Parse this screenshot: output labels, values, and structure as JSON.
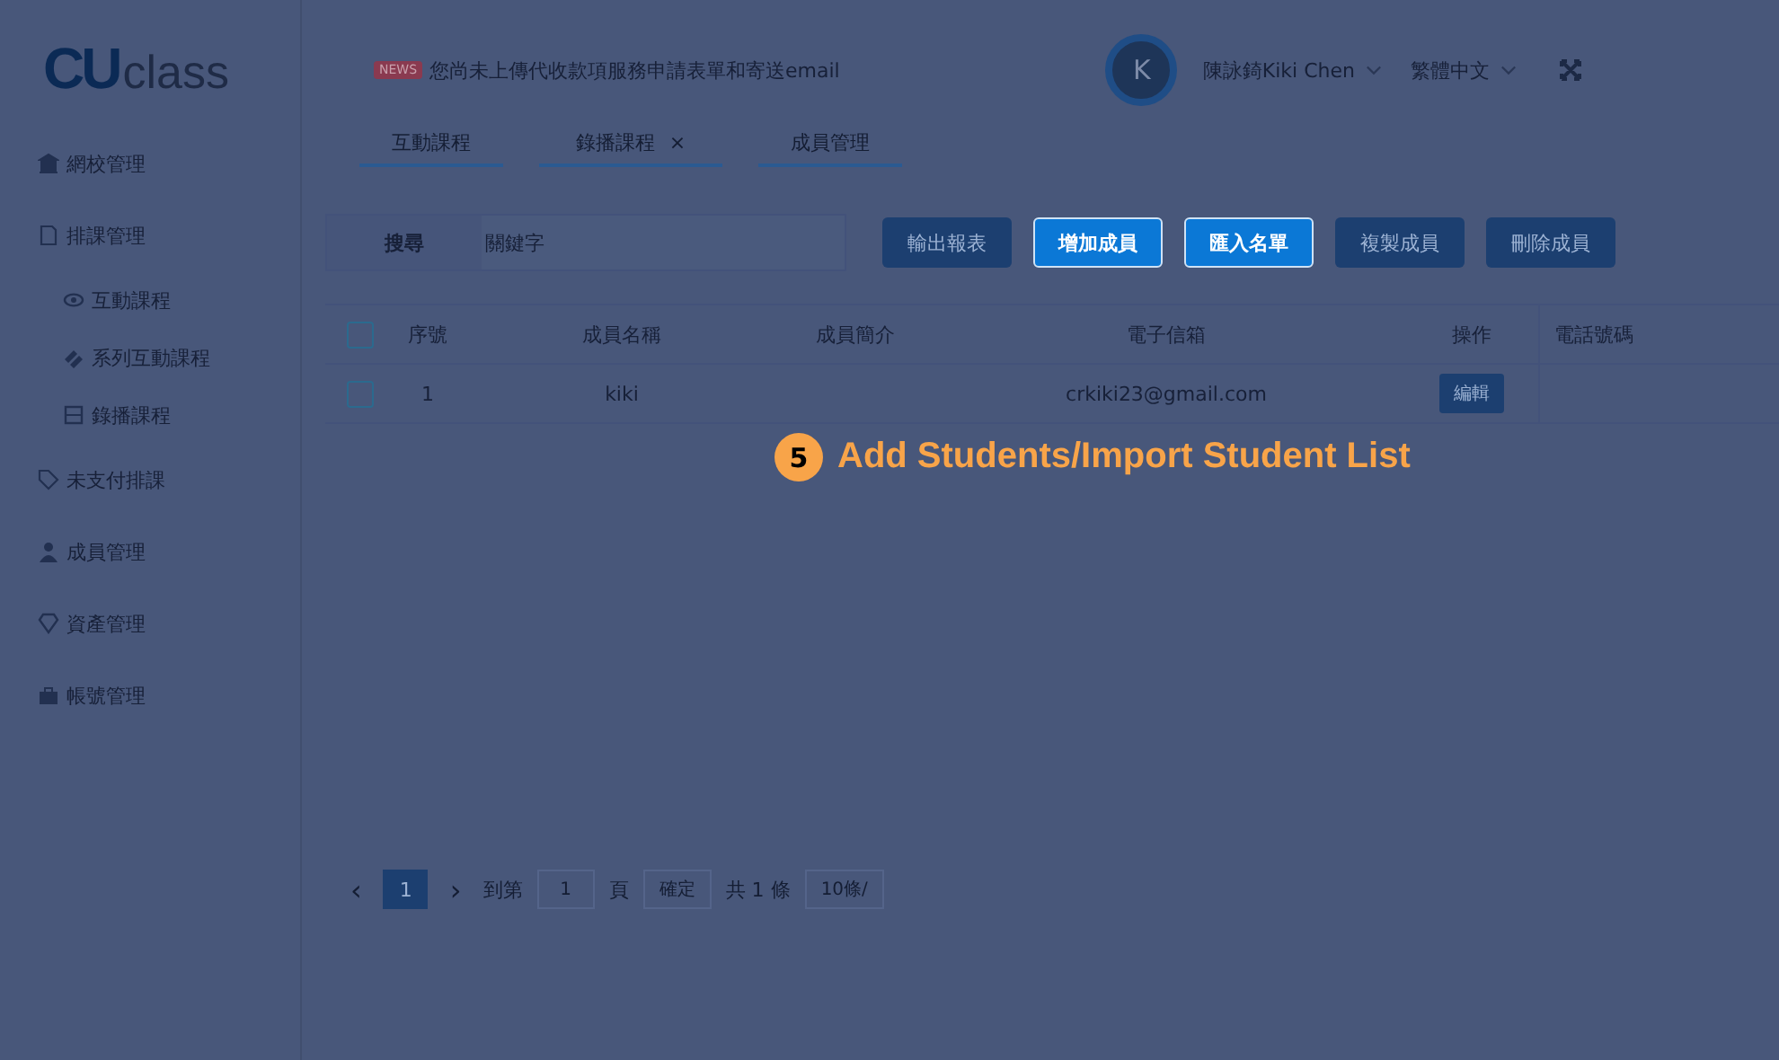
{
  "logo": {
    "mark": "CU",
    "text": "class"
  },
  "notice": {
    "badge": "NEWS",
    "text": "您尚未上傳代收款項服務申請表單和寄送email"
  },
  "user": {
    "avatar": "K",
    "name": "陳詠錡Kiki Chen",
    "language": "繁體中文"
  },
  "sidebar": {
    "items": [
      {
        "label": "網校管理"
      },
      {
        "label": "排課管理",
        "children": [
          {
            "label": "互動課程"
          },
          {
            "label": "系列互動課程"
          },
          {
            "label": "錄播課程"
          }
        ]
      },
      {
        "label": "未支付排課"
      },
      {
        "label": "成員管理"
      },
      {
        "label": "資產管理"
      },
      {
        "label": "帳號管理"
      }
    ]
  },
  "tabs": [
    {
      "label": "互動課程"
    },
    {
      "label": "錄播課程",
      "close": "×"
    },
    {
      "label": "成員管理"
    }
  ],
  "search": {
    "label": "搜尋",
    "placeholder": "關鍵字"
  },
  "buttons": [
    {
      "label": "輸出報表",
      "highlighted": false
    },
    {
      "label": "增加成員",
      "highlighted": true
    },
    {
      "label": "匯入名單",
      "highlighted": true
    },
    {
      "label": "複製成員",
      "highlighted": false
    },
    {
      "label": "刪除成員",
      "highlighted": false
    }
  ],
  "table": {
    "select_all_checked": false,
    "columns": [
      "序號",
      "成員名稱",
      "成員簡介",
      "電子信箱",
      "操作",
      "電話號碼"
    ],
    "rows": [
      {
        "checked": false,
        "cells": [
          "1",
          "kiki",
          "",
          "crkiki23@gmail.com"
        ],
        "action": "編輯"
      }
    ]
  },
  "pagination": {
    "prev": "‹",
    "current": "1",
    "next": "›",
    "goto_label": "到第",
    "goto_value": "1",
    "page_label": "頁",
    "confirm": "確定",
    "total": "共 1 條",
    "page_size": "10條/"
  },
  "callout": {
    "number": "5",
    "text": "Add Students/Import Student List"
  }
}
